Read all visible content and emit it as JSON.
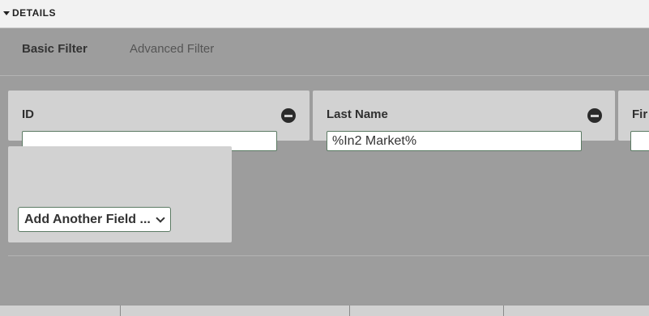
{
  "details": {
    "label": "DETAILS"
  },
  "tabs": [
    {
      "label": "Basic Filter",
      "active": true
    },
    {
      "label": "Advanced Filter",
      "active": false
    }
  ],
  "filters": [
    {
      "label": "ID",
      "value": ""
    },
    {
      "label": "Last Name",
      "value": "%In2 Market%"
    },
    {
      "label": "Fir",
      "value": ""
    }
  ],
  "add_field": {
    "selected": "Add Another Field ..."
  },
  "colors": {
    "panel": "#9d9d9d",
    "card": "#d2d2d2",
    "input_border": "#5b7a63",
    "header": "#f2f2f2"
  }
}
